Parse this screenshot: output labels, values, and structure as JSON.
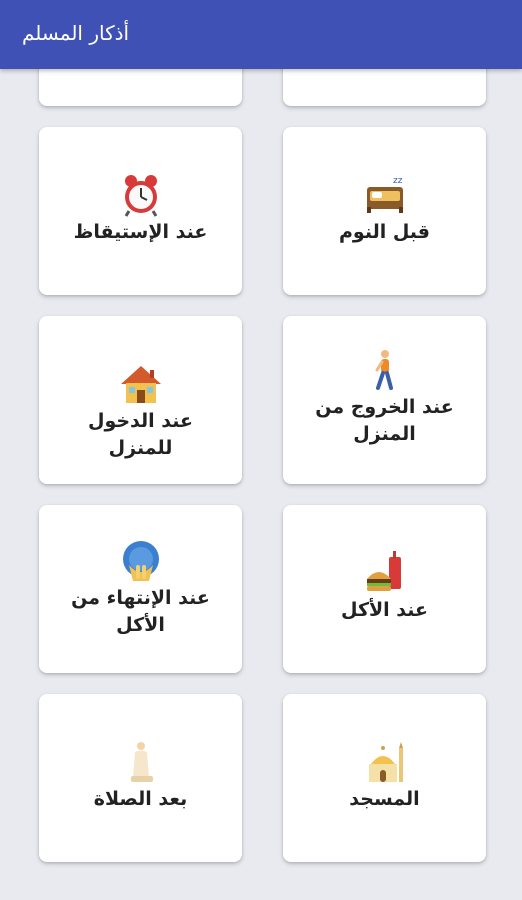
{
  "app_bar": {
    "title": "أذكار المسلم"
  },
  "cards": [
    {
      "label": "",
      "icon": "partial-card-top-left"
    },
    {
      "label": "",
      "icon": "partial-card-top-right"
    },
    {
      "label": "عند الإستيقاظ",
      "icon": "alarm-clock-icon"
    },
    {
      "label": "قبل النوم",
      "icon": "bed-icon"
    },
    {
      "label": "عند الدخول للمنزل",
      "icon": "house-icon"
    },
    {
      "label": "عند الخروج من المنزل",
      "icon": "walking-person-icon"
    },
    {
      "label": "عند الإنتهاء من الأكل",
      "icon": "praying-hands-icon"
    },
    {
      "label": "عند الأكل",
      "icon": "fast-food-icon"
    },
    {
      "label": "بعد الصلاة",
      "icon": "praying-person-icon"
    },
    {
      "label": "المسجد",
      "icon": "mosque-icon"
    }
  ],
  "colors": {
    "app_bar": "#3f51b5",
    "background": "#e8eaf0",
    "card": "#ffffff"
  }
}
